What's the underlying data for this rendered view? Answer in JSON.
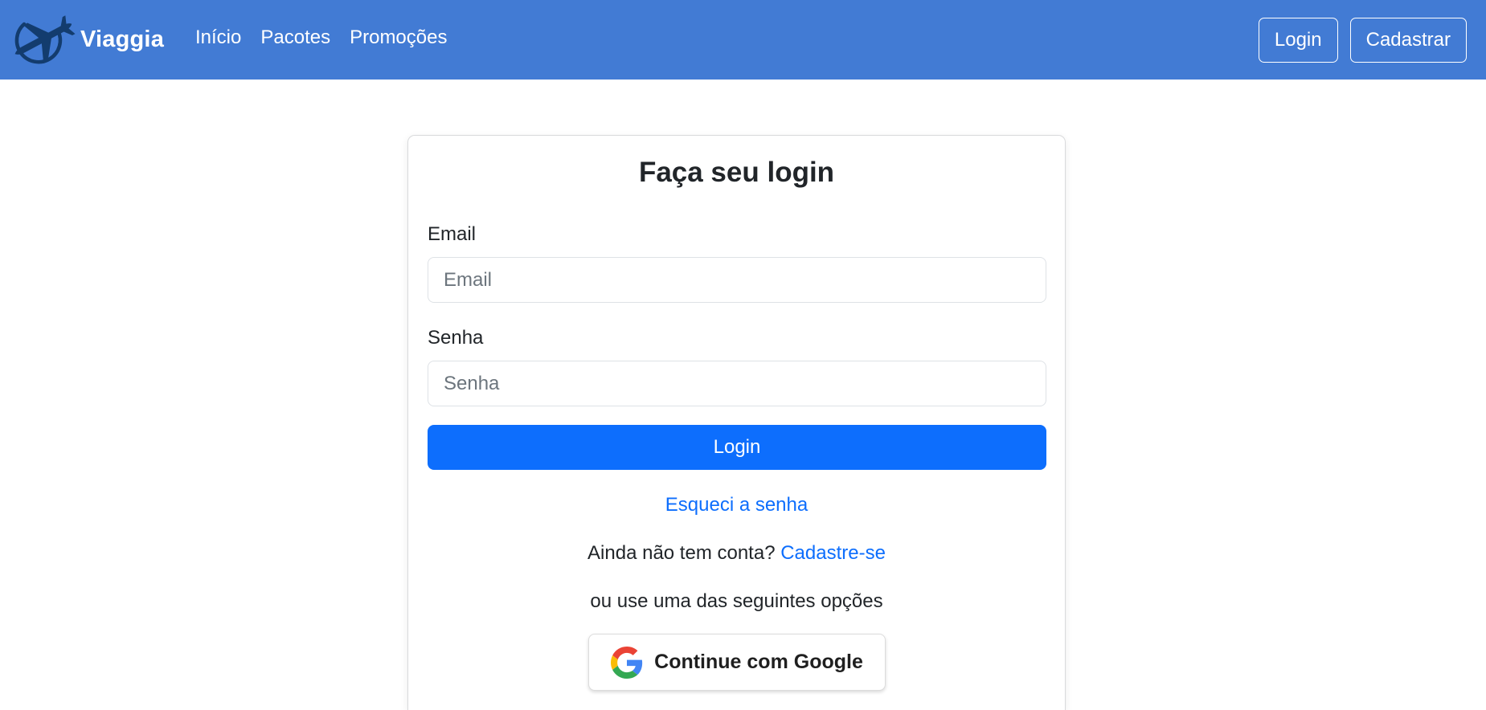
{
  "colors": {
    "navbar_bg": "#427bd4",
    "primary": "#0d6efd",
    "logo": "#133c6e",
    "text": "#212529"
  },
  "navbar": {
    "brand_name": "Viaggia",
    "logo_icon": "airplane-globe-icon",
    "links": [
      {
        "label": "Início"
      },
      {
        "label": "Pacotes"
      },
      {
        "label": "Promoções"
      }
    ],
    "login_label": "Login",
    "signup_label": "Cadastrar"
  },
  "login_form": {
    "title": "Faça seu login",
    "email": {
      "label": "Email",
      "placeholder": "Email",
      "value": ""
    },
    "password": {
      "label": "Senha",
      "placeholder": "Senha",
      "value": ""
    },
    "submit_label": "Login",
    "forgot_password": "Esqueci a senha",
    "no_account_text": "Ainda não tem conta?",
    "signup_link": "Cadastre-se",
    "other_options_text": "ou use uma das seguintes opções",
    "google_button": {
      "label": "Continue com Google",
      "icon": "google-icon"
    }
  }
}
